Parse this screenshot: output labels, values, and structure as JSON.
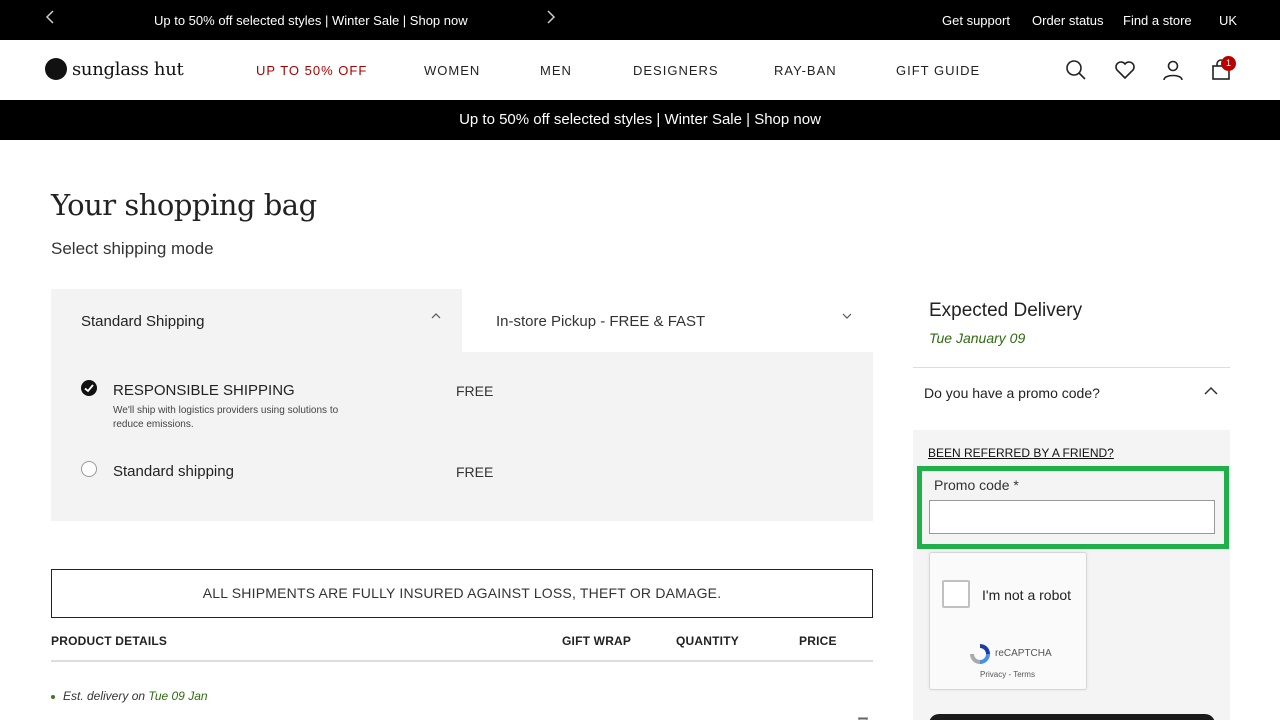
{
  "topbar": {
    "message": "Up to 50% off selected styles | Winter Sale | Shop now",
    "links": [
      "Get support",
      "Order status",
      "Find a store",
      "UK"
    ],
    "prev_icon": "chevron-left-icon",
    "next_icon": "chevron-right-icon"
  },
  "header": {
    "logo_text": "sunglass hut",
    "nav": [
      "UP TO 50% OFF",
      "WOMEN",
      "MEN",
      "DESIGNERS",
      "RAY-BAN",
      "GIFT GUIDE"
    ],
    "cart_count": "1",
    "sale_color": "#a00000"
  },
  "promo_banner": "Up to 50% off selected styles | Winter Sale | Shop now",
  "page": {
    "title": "Your shopping bag",
    "subtitle": "Select shipping mode"
  },
  "shipping": {
    "tabs": [
      "Standard Shipping",
      "In-store Pickup - FREE & FAST"
    ],
    "options": [
      {
        "title": "RESPONSIBLE SHIPPING",
        "description": "We'll ship with logistics providers using solutions to reduce emissions.",
        "price": "FREE",
        "selected": true
      },
      {
        "title": "Standard shipping",
        "price": "FREE",
        "selected": false
      }
    ]
  },
  "insured_notice": "ALL SHIPMENTS ARE FULLY INSURED AGAINST LOSS, THEFT OR DAMAGE.",
  "table": {
    "headers": [
      "PRODUCT DETAILS",
      "GIFT WRAP",
      "QUANTITY",
      "PRICE"
    ]
  },
  "delivery_estimate": {
    "prefix": "Est. delivery on",
    "date": "Tue 09 Jan"
  },
  "sidebar": {
    "expected_title": "Expected Delivery",
    "expected_date": "Tue January 09",
    "promo_question": "Do you have a promo code?",
    "referred_link": "BEEN REFERRED BY A FRIEND?",
    "promo_label": "Promo code *",
    "promo_value": ""
  },
  "captcha": {
    "label": "I'm not a robot",
    "brand": "reCAPTCHA",
    "terms": "Privacy - Terms"
  },
  "colors": {
    "accent_green": "#2f6b10",
    "highlight": "#1fb04a"
  }
}
